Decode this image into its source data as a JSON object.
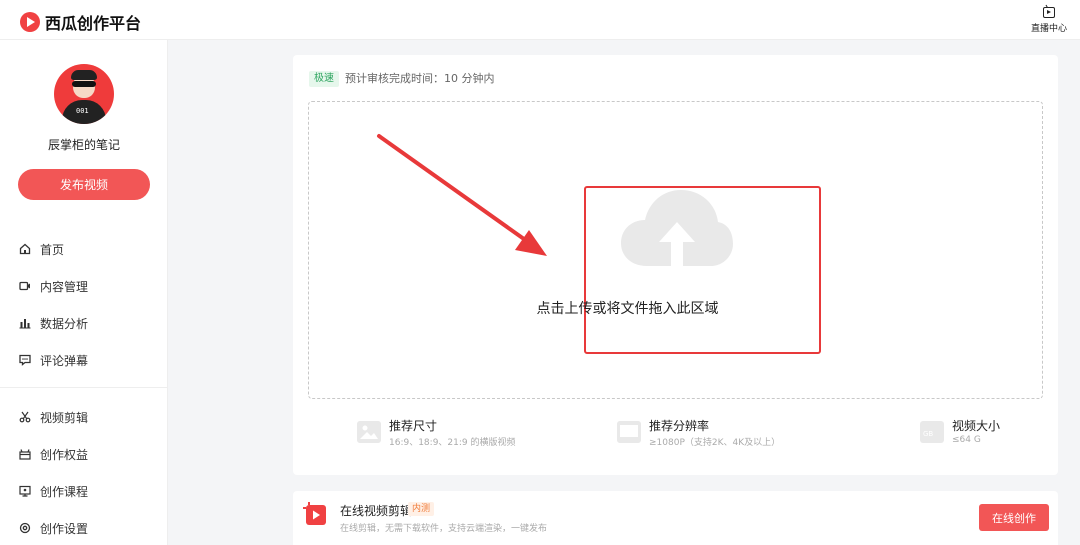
{
  "header": {
    "logo_text": "西瓜创作平台",
    "live_center_label": "直播中心"
  },
  "sidebar": {
    "username": "辰掌柜的笔记",
    "publish_label": "发布视频",
    "nav_group1": [
      {
        "label": "首页",
        "icon": "home-icon"
      },
      {
        "label": "内容管理",
        "icon": "video-icon"
      },
      {
        "label": "数据分析",
        "icon": "bar-chart-icon"
      },
      {
        "label": "评论弹幕",
        "icon": "comment-icon"
      }
    ],
    "nav_group2": [
      {
        "label": "视频剪辑",
        "icon": "scissors-icon"
      },
      {
        "label": "创作权益",
        "icon": "gift-icon"
      },
      {
        "label": "创作课程",
        "icon": "course-icon"
      },
      {
        "label": "创作设置",
        "icon": "gear-icon"
      }
    ]
  },
  "upload": {
    "fast_tag": "极速",
    "review_time": "预计审核完成时间：10 分钟内",
    "upload_prompt": "点击上传或将文件拖入此区域",
    "specs": [
      {
        "title": "推荐尺寸",
        "desc": "16:9、18:9、21:9 的横版视频",
        "icon": "image-icon"
      },
      {
        "title": "推荐分辨率",
        "desc": "≥1080P（支持2K、4K及以上）",
        "icon": "monitor-icon"
      },
      {
        "title": "视频大小",
        "desc": "≤64 G",
        "icon": "gb-icon"
      }
    ]
  },
  "online_edit": {
    "title": "在线视频剪辑",
    "beta_tag": "内测",
    "desc": "在线剪辑，无需下载软件，支持云端渲染，一键发布",
    "button_label": "在线创作"
  },
  "colors": {
    "accent": "#f25656",
    "highlight": "#e8393a",
    "fast_tag": "#2fa560",
    "beta_tag": "#f07c3a"
  }
}
